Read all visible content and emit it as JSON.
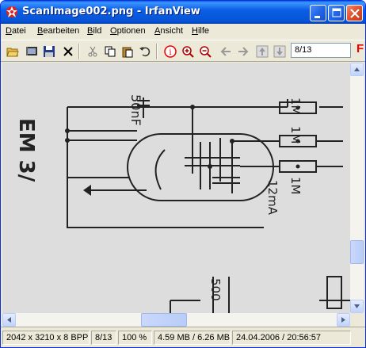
{
  "window": {
    "title": "ScanImage002.png - IrfanView"
  },
  "menu": {
    "items": [
      {
        "accel": "D",
        "rest": "atei"
      },
      {
        "accel": "B",
        "rest": "earbeiten"
      },
      {
        "accel": "B",
        "rest": "ild"
      },
      {
        "accel": "O",
        "rest": "ptionen"
      },
      {
        "accel": "A",
        "rest": "nsicht"
      },
      {
        "accel": "H",
        "rest": "ilfe"
      }
    ]
  },
  "toolbar": {
    "page_indicator": "8/13",
    "brand_glyph": "F",
    "icons": [
      "open-folder-icon",
      "slideshow-icon",
      "save-icon",
      "delete-icon",
      "cut-icon",
      "copy-icon",
      "paste-icon",
      "undo-icon",
      "info-icon",
      "zoom-in-icon",
      "zoom-out-icon",
      "previous-icon",
      "next-icon",
      "first-page-icon",
      "last-page-icon"
    ]
  },
  "image": {
    "labels": [
      "50nF",
      "1M",
      "1M",
      "1M",
      "12mA",
      "EM 3/",
      "500"
    ]
  },
  "status": {
    "dimensions": "2042 x 3210 x 8 BPP",
    "page": "8/13",
    "zoom": "100 %",
    "size": "4.59 MB / 6.26 MB",
    "datetime": "24.04.2006 / 20:56:57"
  },
  "colors": {
    "titlebar": "#0a5ae8",
    "close_button": "#e0502c",
    "window_face": "#ece9d8"
  }
}
